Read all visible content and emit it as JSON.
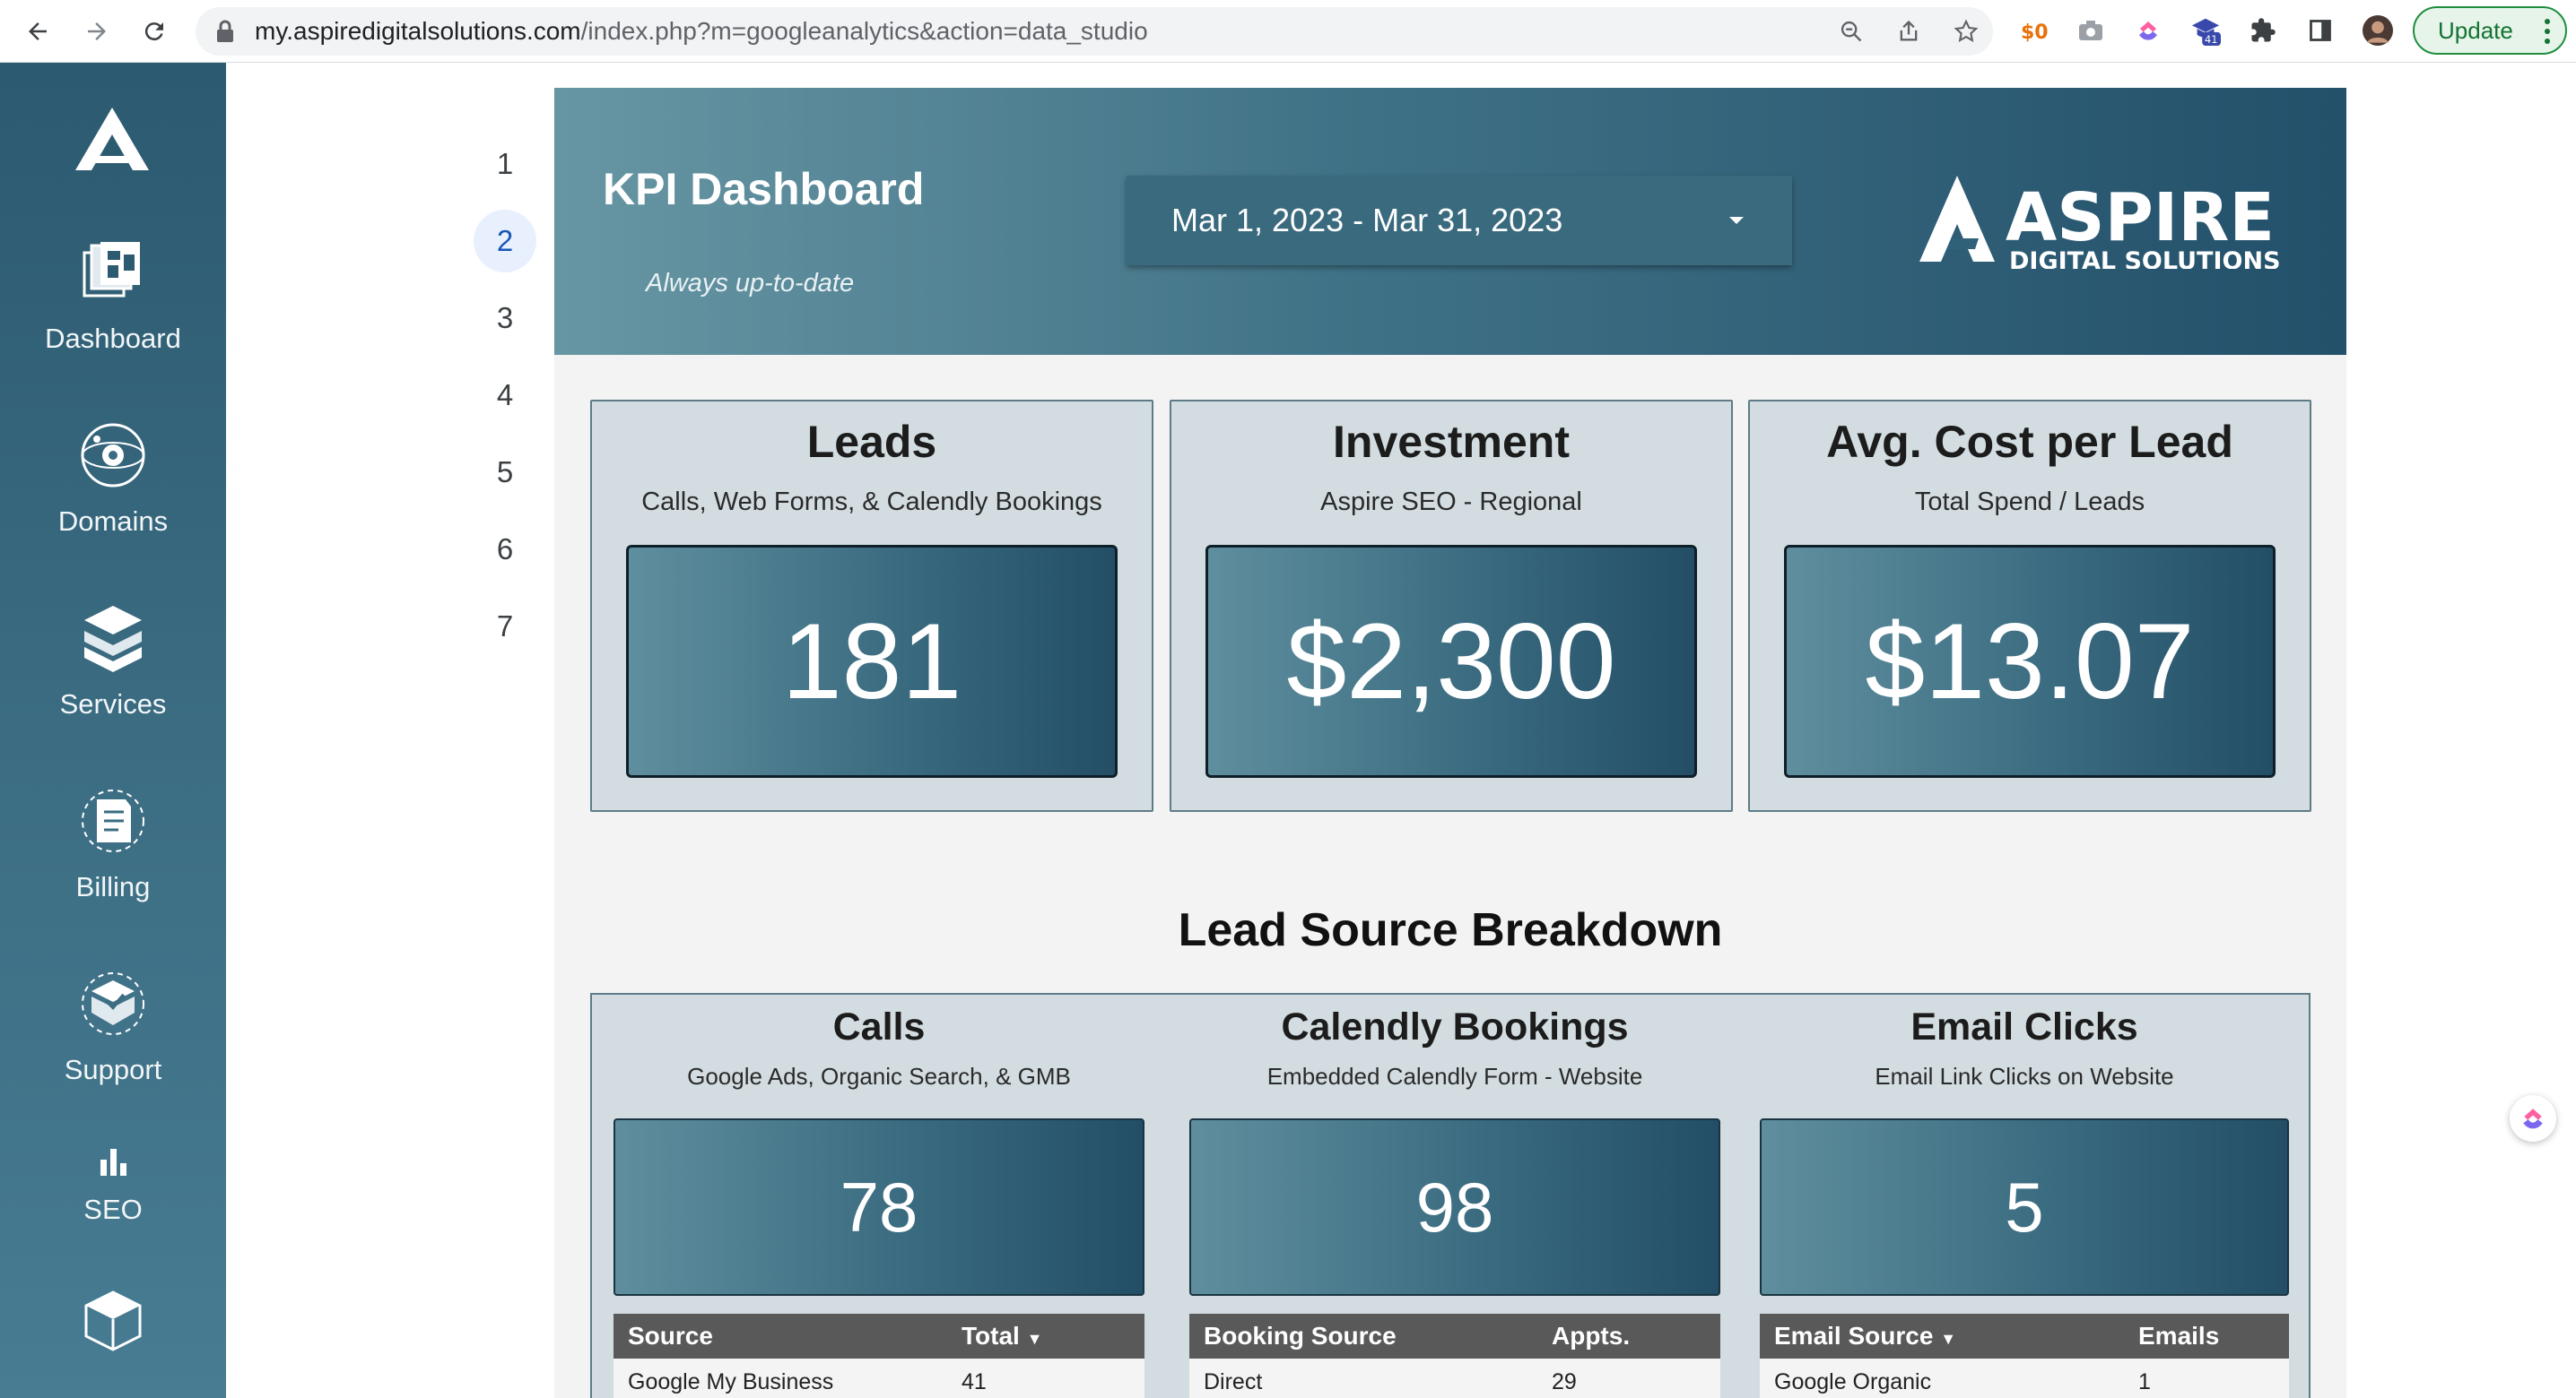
{
  "browser": {
    "url_host": "my.aspiredigitalsolutions.com",
    "url_path": "/index.php?m=googleanalytics&action=data_studio",
    "extension_badge": "41",
    "update_label": "Update"
  },
  "sidebar": {
    "items": [
      {
        "label": "Dashboard",
        "icon": "dashboard-icon"
      },
      {
        "label": "Domains",
        "icon": "domains-icon"
      },
      {
        "label": "Services",
        "icon": "services-icon"
      },
      {
        "label": "Billing",
        "icon": "billing-icon"
      },
      {
        "label": "Support",
        "icon": "support-icon"
      },
      {
        "label": "SEO",
        "icon": "bar-chart-icon"
      },
      {
        "label": "",
        "icon": "store-icon"
      }
    ]
  },
  "pages": {
    "items": [
      "1",
      "2",
      "3",
      "4",
      "5",
      "6",
      "7"
    ],
    "active": "2"
  },
  "report": {
    "title": "KPI Dashboard",
    "subtitle": "Always up-to-date",
    "date_range": "Mar 1, 2023 - Mar 31, 2023",
    "brand_name": "ASPIRE",
    "brand_tagline": "DIGITAL SOLUTIONS",
    "kpis": [
      {
        "title": "Leads",
        "subtitle": "Calls, Web Forms, & Calendly Bookings",
        "value": "181"
      },
      {
        "title": "Investment",
        "subtitle": "Aspire SEO - Regional",
        "value": "$2,300"
      },
      {
        "title": "Avg. Cost per Lead",
        "subtitle": "Total Spend / Leads",
        "value": "$13.07"
      }
    ],
    "breakdown_title": "Lead Source Breakdown",
    "breakdown": [
      {
        "title": "Calls",
        "subtitle": "Google Ads, Organic Search, & GMB",
        "value": "78",
        "col1": "Source",
        "col2": "Total",
        "col1_sorted": false,
        "col2_sorted": true,
        "rows": [
          {
            "a": "Google My Business",
            "b": "41"
          }
        ]
      },
      {
        "title": "Calendly Bookings",
        "subtitle": "Embedded Calendly Form - Website",
        "value": "98",
        "col1": "Booking Source",
        "col2": "Appts.",
        "col1_sorted": false,
        "col2_sorted": false,
        "rows": [
          {
            "a": "Direct",
            "b": "29"
          }
        ]
      },
      {
        "title": "Email Clicks",
        "subtitle": "Email Link Clicks on Website",
        "value": "5",
        "col1": "Email Source",
        "col2": "Emails",
        "col1_sorted": true,
        "col2_sorted": false,
        "rows": [
          {
            "a": "Google Organic",
            "b": "1"
          }
        ]
      }
    ]
  },
  "colors": {
    "sidebar": "#2c5a70",
    "banner_dark": "#23506a",
    "card_bg": "#d3dde1",
    "update_green": "#1e8e3e"
  }
}
